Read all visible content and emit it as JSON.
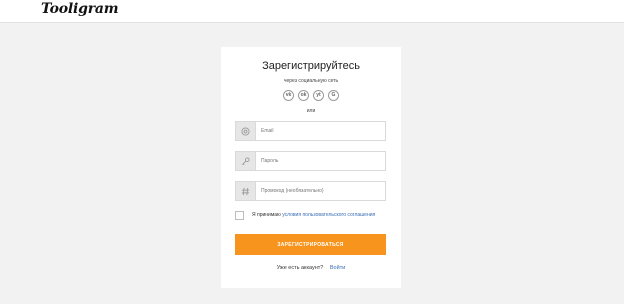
{
  "header": {
    "logo": "Tooligram"
  },
  "form": {
    "title": "Зарегистрируйтесь",
    "subtitle": "через социальную сеть",
    "socials": [
      {
        "icon": "vk-icon",
        "glyph": "vk"
      },
      {
        "icon": "odnoklassniki-icon",
        "glyph": "ok"
      },
      {
        "icon": "youtube-icon",
        "glyph": "yt"
      },
      {
        "icon": "google-icon",
        "glyph": "G"
      }
    ],
    "or": "или",
    "fields": {
      "email": {
        "placeholder": "Email",
        "icon": "at-icon"
      },
      "password": {
        "placeholder": "Пароль",
        "icon": "key-icon"
      },
      "promo": {
        "placeholder": "Промокод (необязательно)",
        "icon": "hash-icon"
      }
    },
    "agree_text": "Я принимаю",
    "agree_link": "условия пользовательского соглашения",
    "submit_label": "ЗАРЕГИСТРИРОВАТЬСЯ",
    "have_account": "Уже есть аккаунт?",
    "login_link": "Войти"
  },
  "colors": {
    "accent": "#f7941d",
    "link": "#3b6fb6",
    "background": "#f2f2f2"
  }
}
